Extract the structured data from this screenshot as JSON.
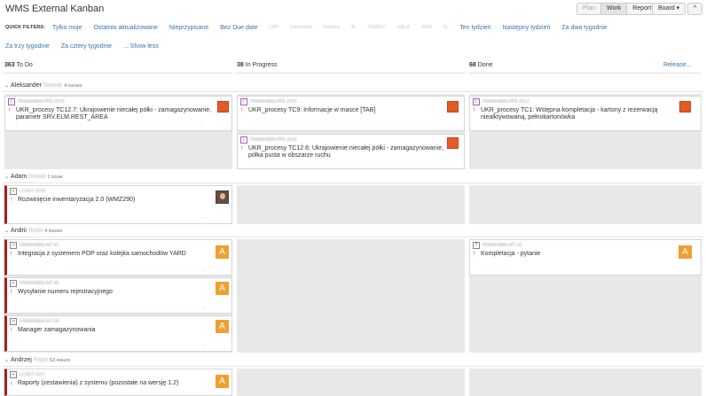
{
  "header": {
    "title": "WMS External Kanban",
    "views": [
      "Plan",
      "Work",
      "Report"
    ],
    "board_label": "Board ▾",
    "collapse_label": "^"
  },
  "filters": {
    "label": "QUICK FILTERS:",
    "row1": [
      "Tylko moje",
      "Ostatnio aktualizowane",
      "Nieprzypisane",
      "Bez Due date",
      "LPP",
      "Cleveland",
      "Paletsa",
      "IE",
      "TOWSU",
      "HALA",
      "SEM",
      "IC",
      "Ten tydzień",
      "Następny tydzień",
      "Za dwa tygodnie"
    ],
    "row2": [
      "Za trzy tygodnie",
      "Za cztery tygodnie",
      "... Show less"
    ]
  },
  "columns": [
    {
      "count": "363",
      "name": "To Do"
    },
    {
      "count": "38",
      "name": "In Progress"
    },
    {
      "count": "68",
      "name": "Done"
    }
  ],
  "release_label": "Release...",
  "swimlanes": [
    {
      "name": "Aleksander",
      "surname": "Nowak",
      "count": "4 issues"
    },
    {
      "name": "Adam",
      "surname": "Kowal",
      "count": "1 issue"
    },
    {
      "name": "Andrii",
      "surname": "Bodo",
      "count": "4 issues"
    },
    {
      "name": "Andrzej",
      "surname": "Papa",
      "count": "53 issues"
    }
  ],
  "cards": {
    "c1": {
      "key": "FRANKMAN-PPE-2019",
      "summary1": "UKR_procesy TC12.7: Ukrajowienie niecałej półki - zamagazynowanie,",
      "summary2": "parametr SRV.ELM.REST_AREA"
    },
    "c2": {
      "key": "FRANKMAN-PPE-2020",
      "summary1": "UKR_procesy TC9: Informacje w masce [TAB]",
      "summary2": ""
    },
    "c3": {
      "key": "FRANKMAN-PPE-2012",
      "summary1": "UKR_procesy TC1: Wstępna kompletacja - kartony z rezerwacją",
      "summary2": "niealktywowaną, pełnokartonówka"
    },
    "c4": {
      "key": "FRANKMAN-PPE-2018",
      "summary1": "UKR_procesy TC12.6: Ukrajowienie niecałej półki - zamagazynowanie,",
      "summary2": "półka pusta w obszarze ruchu"
    },
    "c5": {
      "key": "LCADT-1018",
      "summary1": "Rozwinięcie inwentaryzacja 2.0 (WMZ290)",
      "summary2": ""
    },
    "c6": {
      "key": "FRANKMAN-WT-41",
      "summary1": "Integracja z systemem POP oraz kolejka samochodów YARD",
      "summary2": ""
    },
    "c7": {
      "key": "FRANKMAN-WT-42",
      "summary1": "Kompletacja - pytanie",
      "summary2": ""
    },
    "c8": {
      "key": "FRANKMAN-WT-40",
      "summary1": "Wysyłanie numeru rejestracyjnego",
      "summary2": ""
    },
    "c9": {
      "key": "FRANKMAN-WT-39",
      "summary1": "Manager zamagazynowania",
      "summary2": ""
    },
    "c10": {
      "key": "LCADT-1107",
      "summary1": "Raporty (zestawienia) z systemu (pozostałe na wersję 1.2)",
      "summary2": ""
    }
  },
  "avatar_letter": "A",
  "icons": {
    "story": "story-icon",
    "task": "task-icon",
    "question": "question-icon",
    "priority_up": "↑",
    "priority_down": "↓"
  }
}
